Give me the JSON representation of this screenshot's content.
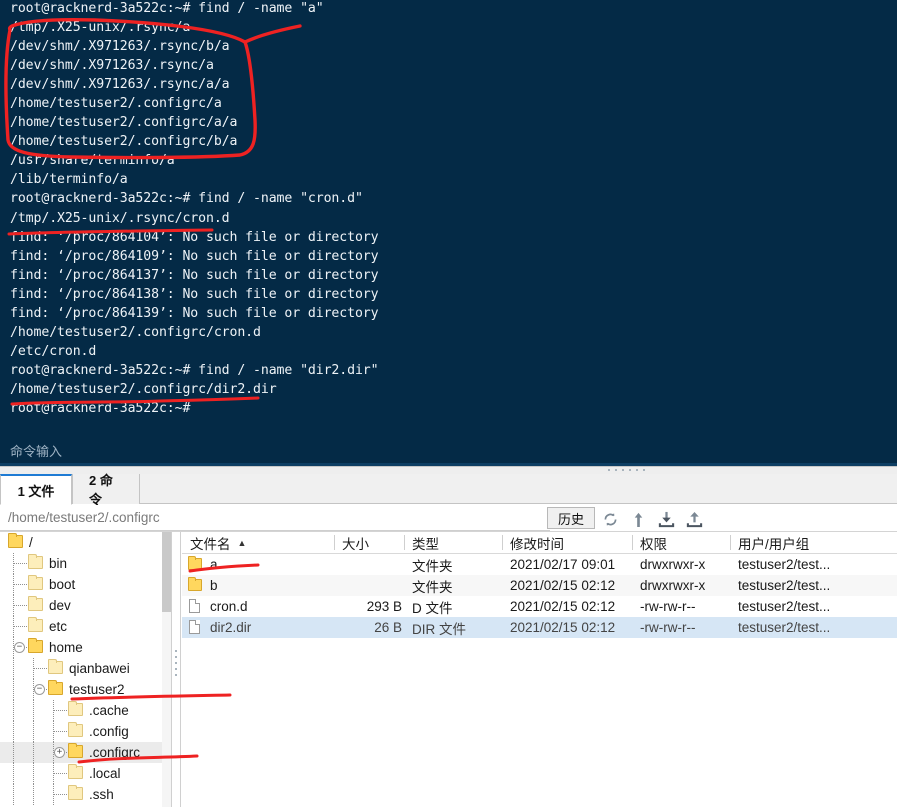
{
  "terminal": {
    "background_color": "#042a46",
    "text_color": "#eef3f7",
    "lines": [
      "/lib/terminfo/a",
      "root@racknerd-3a522c:~# find / -name \"a\"",
      "/tmp/.X25-unix/.rsync/a",
      "/dev/shm/.X971263/.rsync/b/a",
      "/dev/shm/.X971263/.rsync/a",
      "/dev/shm/.X971263/.rsync/a/a",
      "/home/testuser2/.configrc/a",
      "/home/testuser2/.configrc/a/a",
      "/home/testuser2/.configrc/b/a",
      "/usr/share/terminfo/a",
      "/lib/terminfo/a",
      "root@racknerd-3a522c:~# find / -name \"cron.d\"",
      "/tmp/.X25-unix/.rsync/cron.d",
      "find: ‘/proc/864104’: No such file or directory",
      "find: ‘/proc/864109’: No such file or directory",
      "find: ‘/proc/864137’: No such file or directory",
      "find: ‘/proc/864138’: No such file or directory",
      "find: ‘/proc/864139’: No such file or directory",
      "/home/testuser2/.configrc/cron.d",
      "/etc/cron.d",
      "root@racknerd-3a522c:~# find / -name \"dir2.dir\"",
      "/home/testuser2/.configrc/dir2.dir",
      "root@racknerd-3a522c:~#"
    ],
    "command_input_placeholder": "命令输入"
  },
  "tabs": [
    {
      "label": "1 文件",
      "active": true
    },
    {
      "label": "2 命令",
      "active": false
    }
  ],
  "path_bar": {
    "value": "/home/testuser2/.configrc",
    "history_label": "历史",
    "icons": [
      "refresh-icon",
      "go-up-icon",
      "download-icon",
      "upload-icon"
    ]
  },
  "tree": [
    {
      "label": "/",
      "depth": 0,
      "expander": "",
      "selected": false,
      "icon": "folder"
    },
    {
      "label": "bin",
      "depth": 1,
      "expander": "",
      "selected": false,
      "icon": "folder-light"
    },
    {
      "label": "boot",
      "depth": 1,
      "expander": "",
      "selected": false,
      "icon": "folder-light"
    },
    {
      "label": "dev",
      "depth": 1,
      "expander": "",
      "selected": false,
      "icon": "folder-light"
    },
    {
      "label": "etc",
      "depth": 1,
      "expander": "",
      "selected": false,
      "icon": "folder-light"
    },
    {
      "label": "home",
      "depth": 1,
      "expander": "−",
      "selected": false,
      "icon": "folder"
    },
    {
      "label": "qianbawei",
      "depth": 2,
      "expander": "",
      "selected": false,
      "icon": "folder-light"
    },
    {
      "label": "testuser2",
      "depth": 2,
      "expander": "−",
      "selected": false,
      "icon": "folder"
    },
    {
      "label": ".cache",
      "depth": 3,
      "expander": "",
      "selected": false,
      "icon": "folder-light"
    },
    {
      "label": ".config",
      "depth": 3,
      "expander": "",
      "selected": false,
      "icon": "folder-light"
    },
    {
      "label": ".configrc",
      "depth": 3,
      "expander": "+",
      "selected": true,
      "icon": "folder"
    },
    {
      "label": ".local",
      "depth": 3,
      "expander": "",
      "selected": false,
      "icon": "folder-light"
    },
    {
      "label": ".ssh",
      "depth": 3,
      "expander": "",
      "selected": false,
      "icon": "folder-light"
    }
  ],
  "file_list": {
    "columns": [
      {
        "label": "文件名",
        "sorted": "asc"
      },
      {
        "label": "大小",
        "sorted": ""
      },
      {
        "label": "类型",
        "sorted": ""
      },
      {
        "label": "修改时间",
        "sorted": ""
      },
      {
        "label": "权限",
        "sorted": ""
      },
      {
        "label": "用户/用户组",
        "sorted": ""
      }
    ],
    "sort_arrow": "▲",
    "rows": [
      {
        "name": "a",
        "size": "",
        "type": "文件夹",
        "modified": "2021/02/17 09:01",
        "perms": "drwxrwxr-x",
        "owner": "testuser2/test...",
        "icon": "folder",
        "selected": false
      },
      {
        "name": "b",
        "size": "",
        "type": "文件夹",
        "modified": "2021/02/15 02:12",
        "perms": "drwxrwxr-x",
        "owner": "testuser2/test...",
        "icon": "folder",
        "selected": false
      },
      {
        "name": "cron.d",
        "size": "293 B",
        "type": "D 文件",
        "modified": "2021/02/15 02:12",
        "perms": "-rw-rw-r--",
        "owner": "testuser2/test...",
        "icon": "doc",
        "selected": false
      },
      {
        "name": "dir2.dir",
        "size": "26 B",
        "type": "DIR 文件",
        "modified": "2021/02/15 02:12",
        "perms": "-rw-rw-r--",
        "owner": "testuser2/test...",
        "icon": "doc",
        "selected": true
      }
    ]
  },
  "annotations": {
    "color": "#ee2222",
    "marks": [
      "ellipse-around-find-a-results",
      "underline-tmp-rsync-cron-d",
      "underline-configrc-dir2-dir",
      "underline-file-a-row",
      "underline-tree-testuser2",
      "underline-tree-configrc"
    ]
  }
}
